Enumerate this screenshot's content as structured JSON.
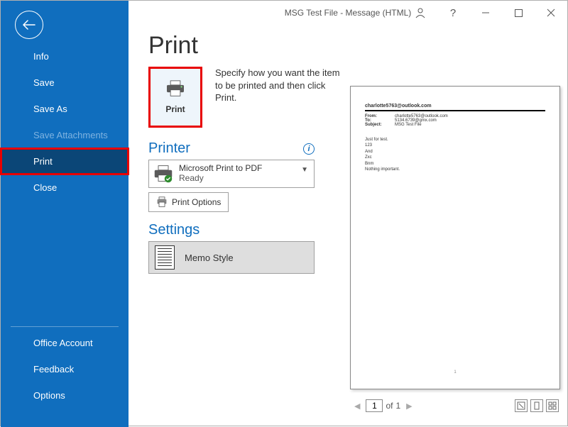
{
  "window": {
    "title": "MSG Test File  -  Message (HTML)"
  },
  "sidebar": {
    "items": [
      {
        "label": "Info"
      },
      {
        "label": "Save"
      },
      {
        "label": "Save As"
      },
      {
        "label": "Save Attachments",
        "disabled": true
      },
      {
        "label": "Print",
        "selected": true
      },
      {
        "label": "Close"
      }
    ],
    "bottom": [
      {
        "label": "Office Account"
      },
      {
        "label": "Feedback"
      },
      {
        "label": "Options"
      }
    ]
  },
  "page": {
    "title": "Print",
    "print_tile_label": "Print",
    "print_description": "Specify how you want the item to be printed and then click Print.",
    "printer_heading": "Printer",
    "printer_name": "Microsoft Print to PDF",
    "printer_status": "Ready",
    "print_options_label": "Print Options",
    "settings_heading": "Settings",
    "memo_style_label": "Memo Style"
  },
  "preview": {
    "email": {
      "from_display": "charlotte5763@outlook.com",
      "from_label": "From:",
      "from_value": "charlotte5763@outlook.com",
      "to_label": "To:",
      "to_value": "5134.6739@gmx.com",
      "subject_label": "Subject:",
      "subject_value": "MSG Test File",
      "body_lines": [
        "Just for test.",
        "123",
        "And",
        "Zxc",
        "Bnm",
        "Nothing important."
      ]
    },
    "footer": {
      "current_page": "1",
      "of_label": "of",
      "total_pages": "1"
    }
  }
}
